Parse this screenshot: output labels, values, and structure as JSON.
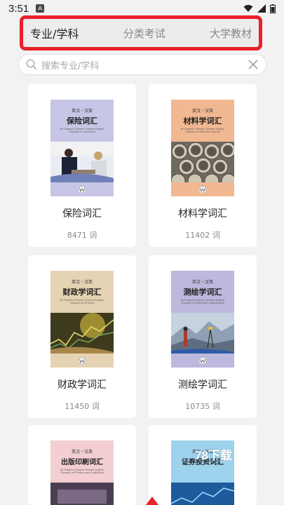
{
  "status": {
    "time": "3:51",
    "badge": "A"
  },
  "tabs": [
    {
      "label": "专业/学科",
      "active": true
    },
    {
      "label": "分类考试",
      "active": false
    },
    {
      "label": "大学教材",
      "active": false
    }
  ],
  "search": {
    "placeholder": "搜索专业/学科"
  },
  "books": [
    {
      "title": "保险词汇",
      "count": "8471 词",
      "cover_title": "保险词汇",
      "cover_sub": "英汉・汉英",
      "cover_en": "An English-Chinese Chinese-English Glossary of Insurance",
      "color": "#c8c6e6"
    },
    {
      "title": "材料学词汇",
      "count": "11402 词",
      "cover_title": "材料学词汇",
      "cover_sub": "英汉・汉英",
      "cover_en": "An English-Chinese Chinese-English Glossary of Material Science",
      "color": "#f1b892"
    },
    {
      "title": "财政学词汇",
      "count": "11450 词",
      "cover_title": "财政学词汇",
      "cover_sub": "英汉・汉英",
      "cover_en": "An English-Chinese Chinese-English Glossary of Finance",
      "color": "#e6d3b3"
    },
    {
      "title": "测绘学词汇",
      "count": "10735 词",
      "cover_title": "测绘学词汇",
      "cover_sub": "英汉・汉英",
      "cover_en": "An English-Chinese Chinese-English Glossary of Geomatics Engineering",
      "color": "#bdb8dd"
    },
    {
      "cover_title": "出版印刷词汇",
      "cover_sub": "英汉・汉英",
      "cover_en": "An English-Chinese Chinese-English Glossary of Printing and Publishing",
      "color": "#f3cfd1"
    },
    {
      "cover_title": "证券投资词汇",
      "cover_sub": "英汉・汉英",
      "cover_en": "",
      "color": "#9ed3ee"
    }
  ],
  "watermark": "78下载"
}
